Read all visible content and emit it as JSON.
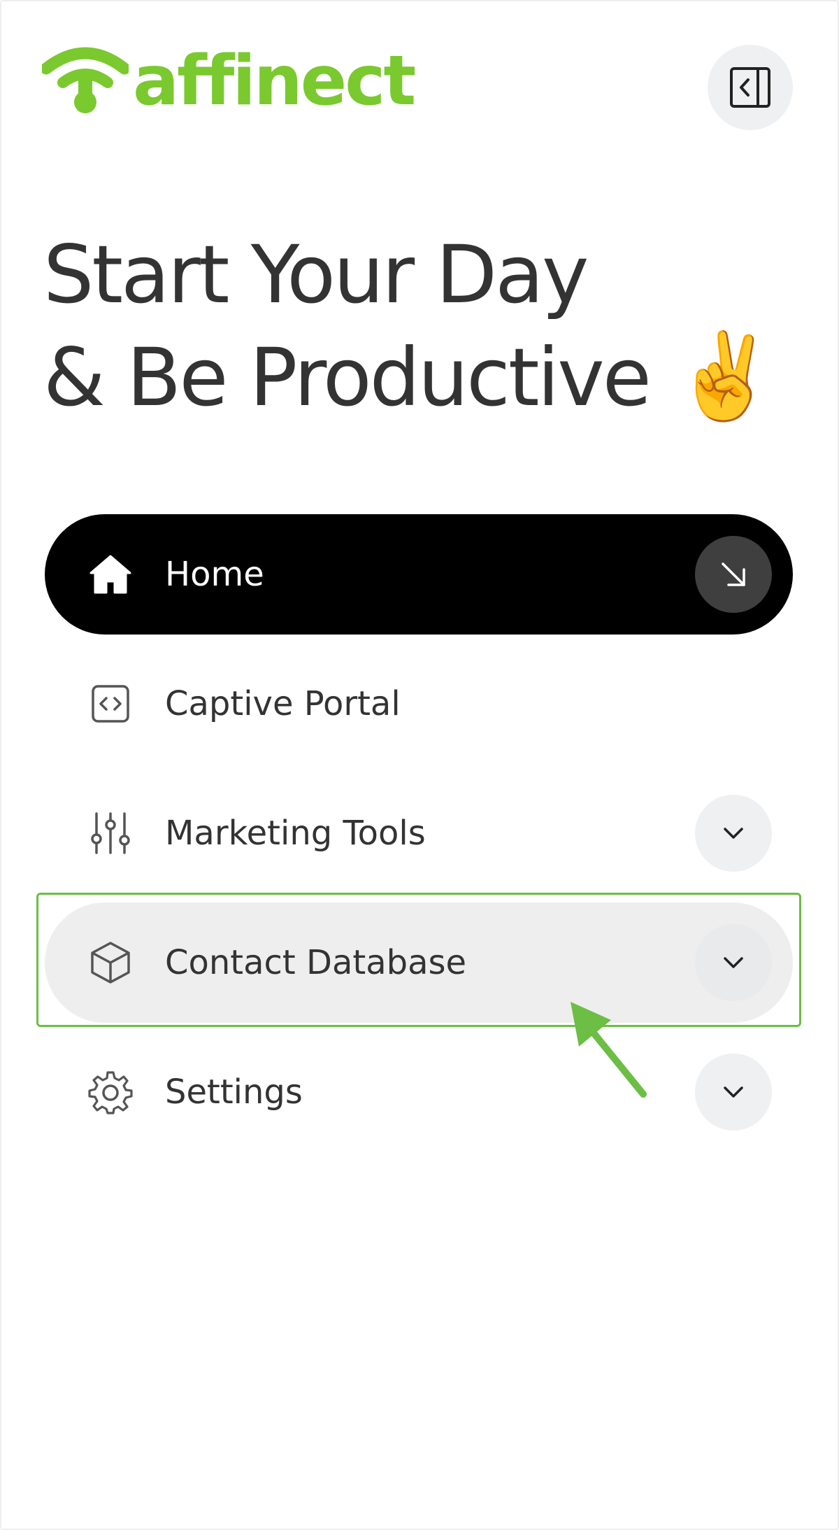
{
  "brand": {
    "name": "affinect",
    "color": "#7ac92f"
  },
  "header": {
    "collapse_icon": "sidebar-collapse-icon"
  },
  "greeting": {
    "line1": "Start Your Day",
    "line2": "& Be Productive",
    "emoji": "✌️"
  },
  "nav": {
    "items": [
      {
        "label": "Home",
        "icon": "home-icon",
        "state": "active",
        "trailing": "arrow-down-right-icon"
      },
      {
        "label": "Captive Portal",
        "icon": "code-icon",
        "state": "default"
      },
      {
        "label": "Marketing Tools",
        "icon": "sliders-icon",
        "state": "default",
        "trailing": "chevron-down-icon"
      },
      {
        "label": "Contact Database",
        "icon": "cube-icon",
        "state": "hover",
        "trailing": "chevron-down-icon"
      },
      {
        "label": "Settings",
        "icon": "gear-icon",
        "state": "default",
        "trailing": "chevron-down-icon"
      }
    ]
  },
  "annotation": {
    "highlight_color": "#6cbe45"
  }
}
